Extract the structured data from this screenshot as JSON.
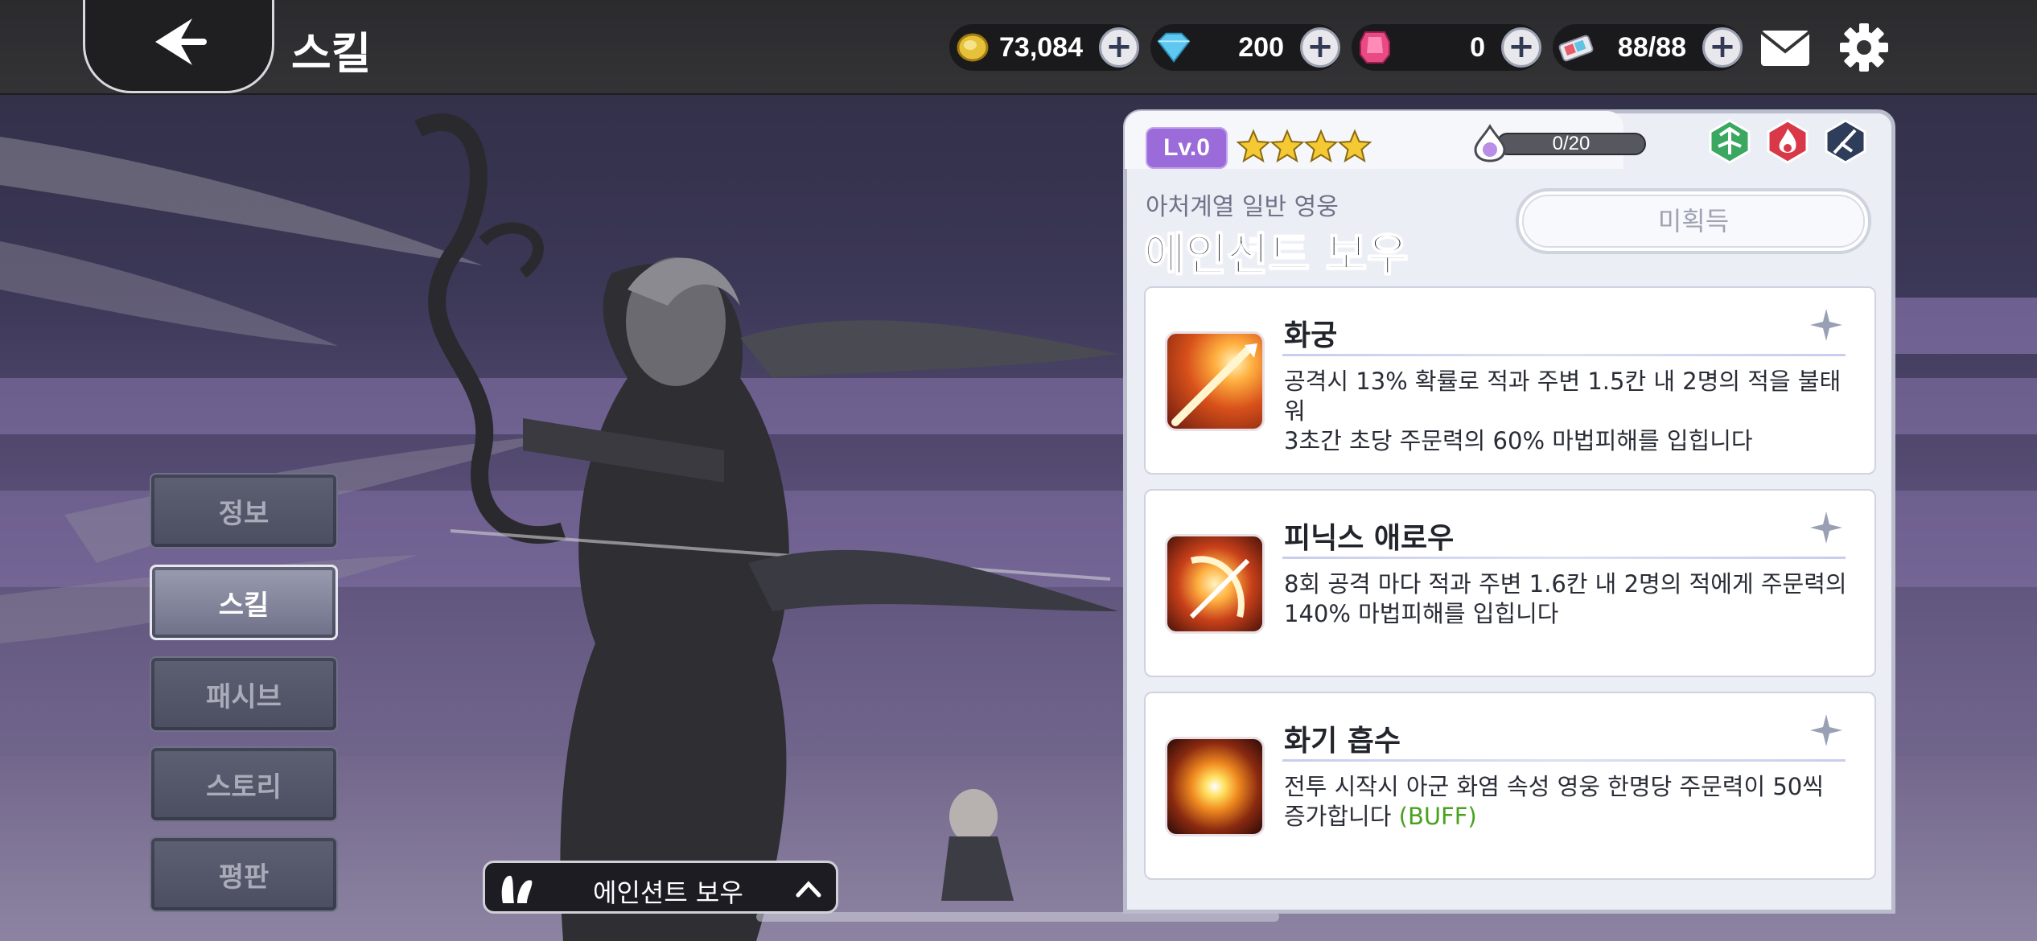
{
  "header": {
    "title": "스킬",
    "currencies": [
      {
        "icon": "gold-coin-icon",
        "value": "73,084"
      },
      {
        "icon": "diamond-icon",
        "value": "200"
      },
      {
        "icon": "ruby-gem-icon",
        "value": "0"
      },
      {
        "icon": "stamina-ticket-icon",
        "value": "88/88"
      }
    ],
    "plus_label": "+"
  },
  "sidebar": {
    "items": [
      {
        "label": "정보",
        "active": false
      },
      {
        "label": "스킬",
        "active": true
      },
      {
        "label": "패시브",
        "active": false
      },
      {
        "label": "스토리",
        "active": false
      },
      {
        "label": "평판",
        "active": false
      }
    ]
  },
  "hero_selector": {
    "name": "에인션트 보우"
  },
  "hero": {
    "level": "Lv.0",
    "stars": 4,
    "exp": "0/20",
    "class": "아처계열 일반 영웅",
    "name": "에인션트 보우",
    "status_button": "미획득"
  },
  "skills": [
    {
      "name": "화궁",
      "desc_line1": "공격시 13% 확률로 적과 주변 1.5칸 내 2명의 적을 불태워",
      "desc_line2": "3초간 초당 주문력의 60% 마법피해를 입힙니다",
      "buff": ""
    },
    {
      "name": "피닉스 애로우",
      "desc_line1": "8회 공격 마다 적과 주변 1.6칸 내 2명의 적에게 주문력의",
      "desc_line2": "140% 마법피해를 입힙니다",
      "buff": ""
    },
    {
      "name": "화기 흡수",
      "desc_line1": "전투 시작시 아군 화염 속성 영웅 한명당 주문력이 50씩",
      "desc_line2": "증가합니다",
      "buff": "(BUFF)"
    }
  ],
  "colors": {
    "level_badge": "#9b6bd9",
    "buff_text": "#4aa120",
    "panel_bg": "#eceef5"
  }
}
